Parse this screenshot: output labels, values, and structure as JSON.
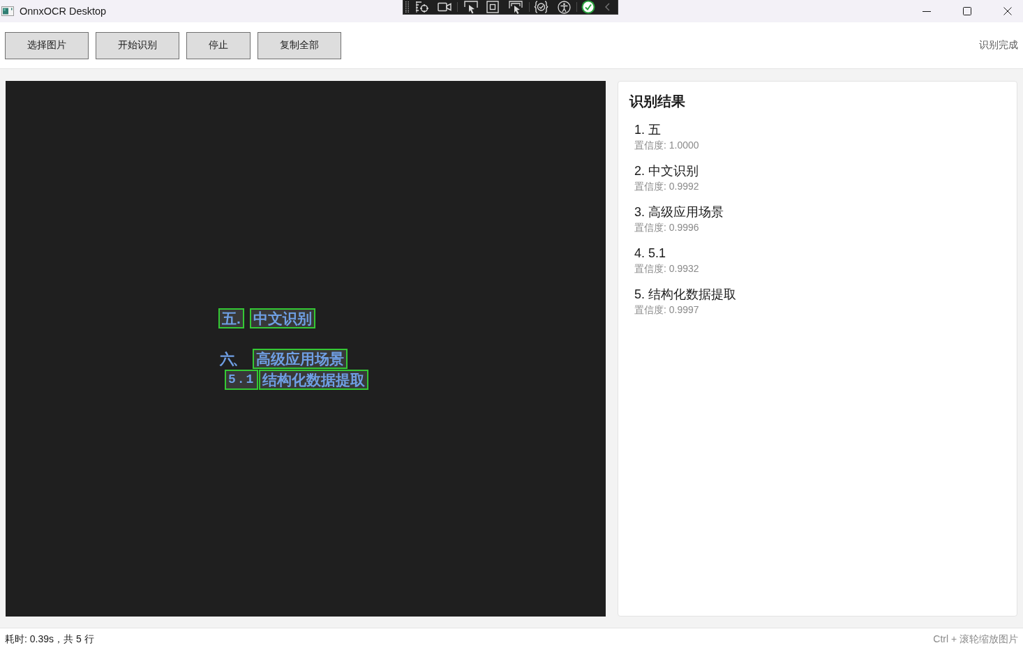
{
  "window": {
    "title": "OnnxOCR Desktop"
  },
  "toolbar": {
    "buttons": [
      "选择图片",
      "开始识别",
      "停止",
      "复制全部"
    ],
    "status": "识别完成"
  },
  "image": {
    "rows": [
      {
        "spans": [
          {
            "text": "五.",
            "kind": "text",
            "boxed": true
          },
          {
            "text": "中文识别",
            "kind": "text",
            "boxed": true
          }
        ]
      },
      {
        "spans": [
          {
            "text": "六、",
            "kind": "text",
            "boxed": false
          },
          {
            "text": "高级应用场景",
            "kind": "text",
            "boxed": true
          }
        ]
      },
      {
        "spans": [
          {
            "text": "5.1",
            "kind": "mono",
            "boxed": true
          },
          {
            "text": "结构化数据提取",
            "kind": "text",
            "boxed": true
          }
        ]
      }
    ]
  },
  "results": {
    "title": "识别结果",
    "items": [
      {
        "text": "1. 五",
        "confidence": "置信度: 1.0000"
      },
      {
        "text": "2. 中文识别",
        "confidence": "置信度: 0.9992"
      },
      {
        "text": "3. 高级应用场景",
        "confidence": "置信度: 0.9996"
      },
      {
        "text": "4. 5.1",
        "confidence": "置信度: 0.9932"
      },
      {
        "text": "5. 结构化数据提取",
        "confidence": "置信度: 0.9997"
      }
    ]
  },
  "status_bar": {
    "left": "耗时: 0.39s，共 5 行",
    "right": "Ctrl + 滚轮缩放图片"
  }
}
